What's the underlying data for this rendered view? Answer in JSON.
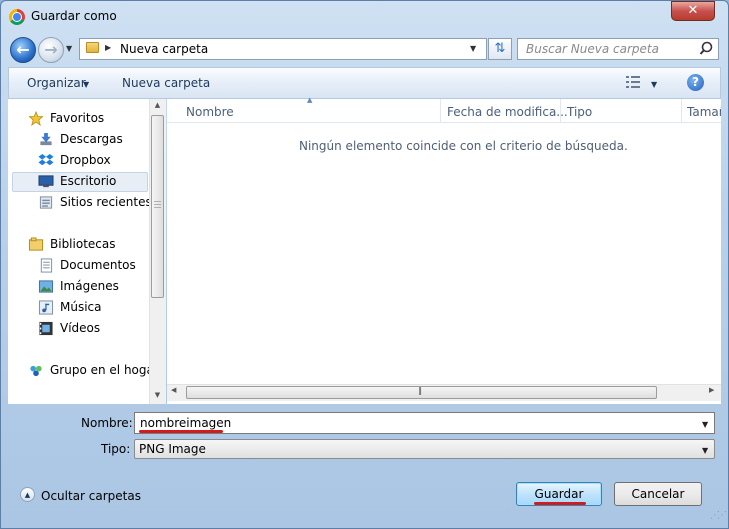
{
  "window": {
    "title": "Guardar como",
    "close_label": "✕"
  },
  "address": {
    "breadcrumb": "Nueva carpeta"
  },
  "search": {
    "placeholder": "Buscar Nueva carpeta"
  },
  "toolbar": {
    "organize_label": "Organizar",
    "new_folder_label": "Nueva carpeta"
  },
  "nav": {
    "items": [
      {
        "label": "Favoritos",
        "icon": "star-icon"
      },
      {
        "label": "Descargas",
        "icon": "downloads-icon"
      },
      {
        "label": "Dropbox",
        "icon": "dropbox-icon"
      },
      {
        "label": "Escritorio",
        "icon": "desktop-icon",
        "selected": true
      },
      {
        "label": "Sitios recientes",
        "icon": "recent-places-icon"
      },
      {
        "label": "Bibliotecas",
        "icon": "libraries-icon"
      },
      {
        "label": "Documentos",
        "icon": "documents-icon"
      },
      {
        "label": "Imágenes",
        "icon": "pictures-icon"
      },
      {
        "label": "Música",
        "icon": "music-icon"
      },
      {
        "label": "Vídeos",
        "icon": "videos-icon"
      },
      {
        "label": "Grupo en el hogar",
        "icon": "homegroup-icon"
      }
    ]
  },
  "list": {
    "columns": [
      "Nombre",
      "Fecha de modifica...",
      "Tipo",
      "Tamañ"
    ],
    "empty_message": "Ningún elemento coincide con el criterio de búsqueda."
  },
  "form": {
    "name_label": "Nombre:",
    "name_value": "nombreimagen",
    "type_label": "Tipo:",
    "type_value": "PNG Image"
  },
  "footer": {
    "hide_folders_label": "Ocultar carpetas",
    "save_label": "Guardar",
    "cancel_label": "Cancelar"
  },
  "colors": {
    "accent": "#3c7fb1",
    "highlight_underline": "#d01c1c"
  }
}
